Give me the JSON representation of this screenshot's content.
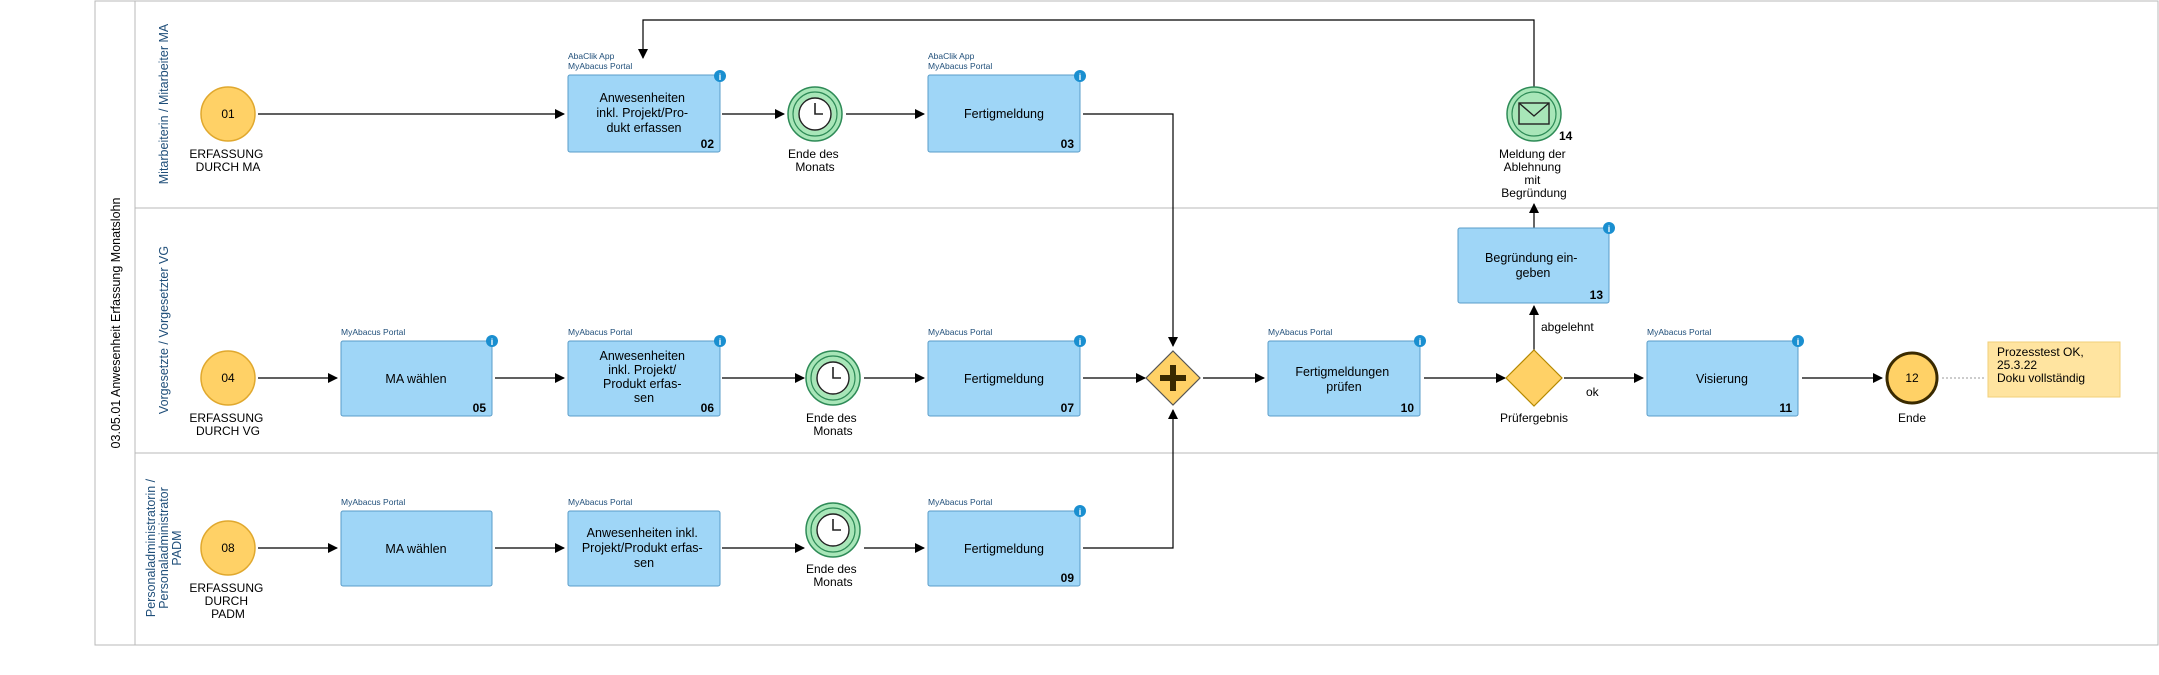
{
  "pool": {
    "title": "03.05.01 Anwesenheit Erfassung Monatslohn"
  },
  "lanes": [
    {
      "label": "Mitarbeiterin / Mitarbeiter MA"
    },
    {
      "label": "Vorgesetzte / Vorgesetzter VG"
    },
    {
      "label_lines": [
        "Personaladministratorin /",
        "Personaladministrator",
        "PADM"
      ]
    }
  ],
  "nodes": {
    "n01": {
      "number": "01",
      "label_lines": [
        "ERFASSUNG",
        "DURCH  MA"
      ]
    },
    "n02": {
      "system_lines": [
        "AbaClik App",
        "MyAbacus Portal"
      ],
      "label_lines": [
        "Anwesenheiten",
        "inkl. Projekt/Pro-",
        "dukt erfassen"
      ],
      "number": "02"
    },
    "timer1": {
      "label_lines": [
        "Ende des",
        "Monats"
      ]
    },
    "n03": {
      "system_lines": [
        "AbaClik App",
        "MyAbacus Portal"
      ],
      "label_lines": [
        "Fertigmeldung"
      ],
      "number": "03"
    },
    "n14": {
      "number": "14",
      "label_lines": [
        "Meldung der",
        "Ablehnung",
        "mit",
        "Begründung"
      ]
    },
    "n04": {
      "number": "04",
      "label_lines": [
        "ERFASSUNG",
        "DURCH VG"
      ]
    },
    "n05": {
      "system_lines": [
        "MyAbacus Portal"
      ],
      "label_lines": [
        "MA wählen"
      ],
      "number": "05"
    },
    "n06": {
      "system_lines": [
        "MyAbacus Portal"
      ],
      "label_lines": [
        "Anwesenheiten",
        "inkl. Projekt/",
        "Produkt erfas-",
        "sen"
      ],
      "number": "06"
    },
    "timer2": {
      "label_lines": [
        "Ende des",
        "Monats"
      ]
    },
    "n07": {
      "system_lines": [
        "MyAbacus Portal"
      ],
      "label_lines": [
        "Fertigmeldung"
      ],
      "number": "07"
    },
    "n10": {
      "system_lines": [
        "MyAbacus Portal"
      ],
      "label_lines": [
        "Fertigmeldungen",
        "prüfen"
      ],
      "number": "10"
    },
    "gw": {
      "label_lines": [
        "Prüfergebnis"
      ]
    },
    "n13": {
      "label_lines": [
        "Begründung ein-",
        "geben"
      ],
      "number": "13"
    },
    "n11": {
      "system_lines": [
        "MyAbacus Portal"
      ],
      "label_lines": [
        "Visierung"
      ],
      "number": "11"
    },
    "n12": {
      "number": "12",
      "label_lines": [
        "Ende"
      ]
    },
    "note": {
      "label_lines": [
        "Prozesstest OK,",
        "25.3.22",
        "Doku vollständig"
      ]
    },
    "n08": {
      "number": "08",
      "label_lines": [
        "ERFASSUNG",
        "DURCH",
        "PADM"
      ]
    },
    "n08a": {
      "system_lines": [
        "MyAbacus Portal"
      ],
      "label_lines": [
        "MA wählen"
      ]
    },
    "n08b": {
      "system_lines": [
        "MyAbacus Portal"
      ],
      "label_lines": [
        "Anwesenheiten inkl.",
        "Projekt/Produkt erfas-",
        "sen"
      ]
    },
    "timer3": {
      "label_lines": [
        "Ende des",
        "Monats"
      ]
    },
    "n09": {
      "system_lines": [
        "MyAbacus Portal"
      ],
      "label_lines": [
        "Fertigmeldung"
      ],
      "number": "09"
    }
  },
  "flows": {
    "rejected": "abgelehnt",
    "ok": "ok"
  },
  "colors": {
    "task_fill": "#9fd6f7",
    "task_stroke": "#5a9cc8",
    "start_fill": "#ffd166",
    "gateway_fill": "#ffd166",
    "timer_fill": "#a8e6b8",
    "note_fill": "#ffe4a0",
    "info_badge": "#1a8fd0"
  }
}
